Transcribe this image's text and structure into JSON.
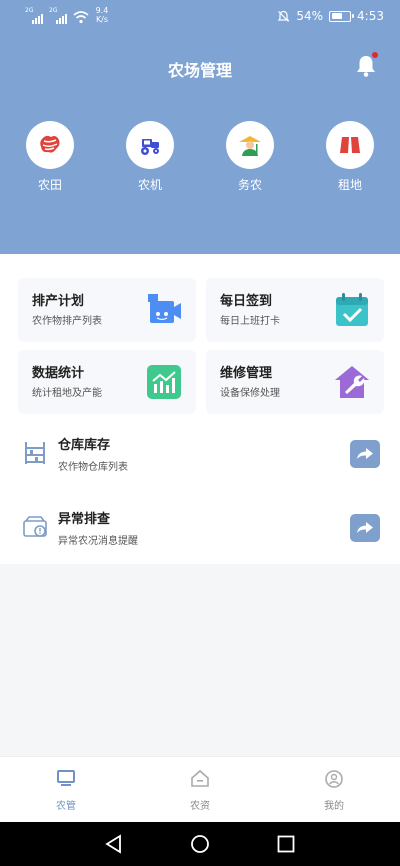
{
  "status_bar": {
    "signal1_tag": "2G",
    "signal2_tag": "2G",
    "net_speed": "9.4",
    "net_unit": "K/s",
    "battery": "54%",
    "time": "4:53"
  },
  "header": {
    "title": "农场管理"
  },
  "categories": [
    {
      "label": "农田",
      "icon": "farmland-icon"
    },
    {
      "label": "农机",
      "icon": "tractor-icon"
    },
    {
      "label": "务农",
      "icon": "farmer-icon"
    },
    {
      "label": "租地",
      "icon": "rent-land-icon"
    }
  ],
  "grid_cards": [
    {
      "title": "排产计划",
      "subtitle": "农作物排产列表",
      "icon": "camera-robot-icon"
    },
    {
      "title": "每日签到",
      "subtitle": "每日上班打卡",
      "icon": "calendar-check-icon"
    },
    {
      "title": "数据统计",
      "subtitle": "统计租地及产能",
      "icon": "chart-icon"
    },
    {
      "title": "维修管理",
      "subtitle": "设备保修处理",
      "icon": "house-wrench-icon"
    }
  ],
  "list_rows": [
    {
      "title": "仓库库存",
      "subtitle": "农作物仓库列表",
      "icon": "shelf-icon"
    },
    {
      "title": "异常排查",
      "subtitle": "异常农况消息提醒",
      "icon": "alert-box-icon"
    }
  ],
  "tabs": [
    {
      "label": "农管",
      "icon": "monitor-icon",
      "active": true
    },
    {
      "label": "农资",
      "icon": "home-icon",
      "active": false
    },
    {
      "label": "我的",
      "icon": "user-icon",
      "active": false
    }
  ],
  "colors": {
    "header_bg": "#7fa3d3",
    "active_tab": "#6f93c7",
    "inactive_tab": "#888888"
  }
}
